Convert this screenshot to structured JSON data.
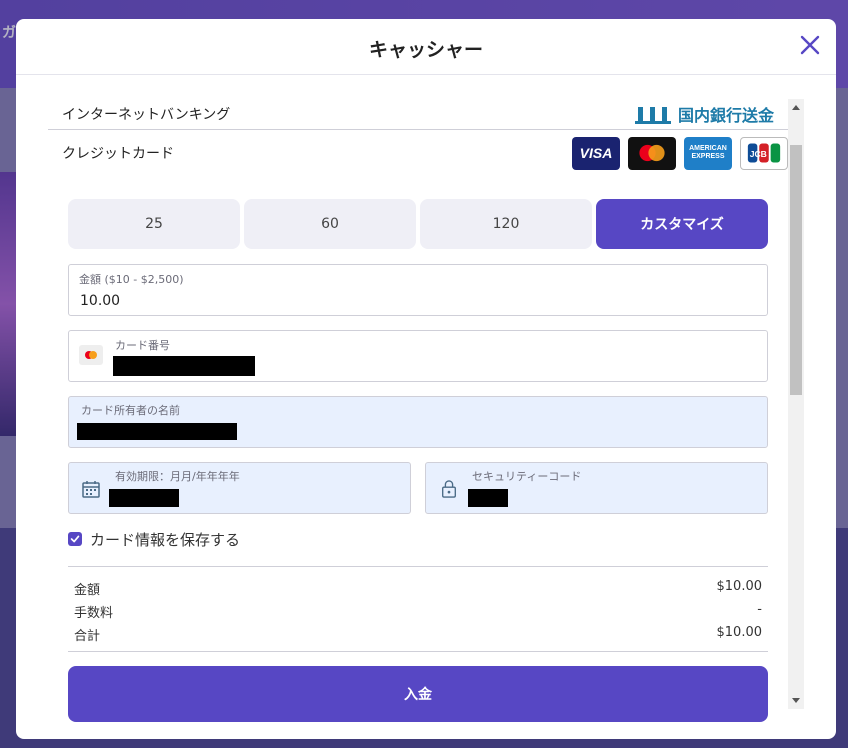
{
  "background": {
    "top_text": "ガ"
  },
  "modal": {
    "title": "キャッシャー"
  },
  "methods": {
    "bank_label": "インターネットバンキング",
    "bank_logo_text": "国内銀行送金",
    "card_label": "クレジットカード",
    "card_logos": {
      "visa": "VISA",
      "amex": "AMERICAN EXPRESS",
      "jcb": "JCB"
    }
  },
  "amounts": [
    "25",
    "60",
    "120",
    "カスタマイズ"
  ],
  "form": {
    "amount_label": "金額 ($10 - $2,500)",
    "amount_value": "10.00",
    "card_number_label": "カード番号",
    "holder_label": "カード所有者の名前",
    "expiry_label": "有効期限：月月/年年年年",
    "cvc_label": "セキュリティーコード",
    "save_label": "カード情報を保存する"
  },
  "summary": {
    "amount_label": "金額",
    "amount_value": "$10.00",
    "fee_label": "手数料",
    "fee_value": "-",
    "total_label": "合計",
    "total_value": "$10.00"
  },
  "deposit_button": "入金",
  "colors": {
    "accent": "#5747c4",
    "field_blue": "#e8f0fe"
  }
}
